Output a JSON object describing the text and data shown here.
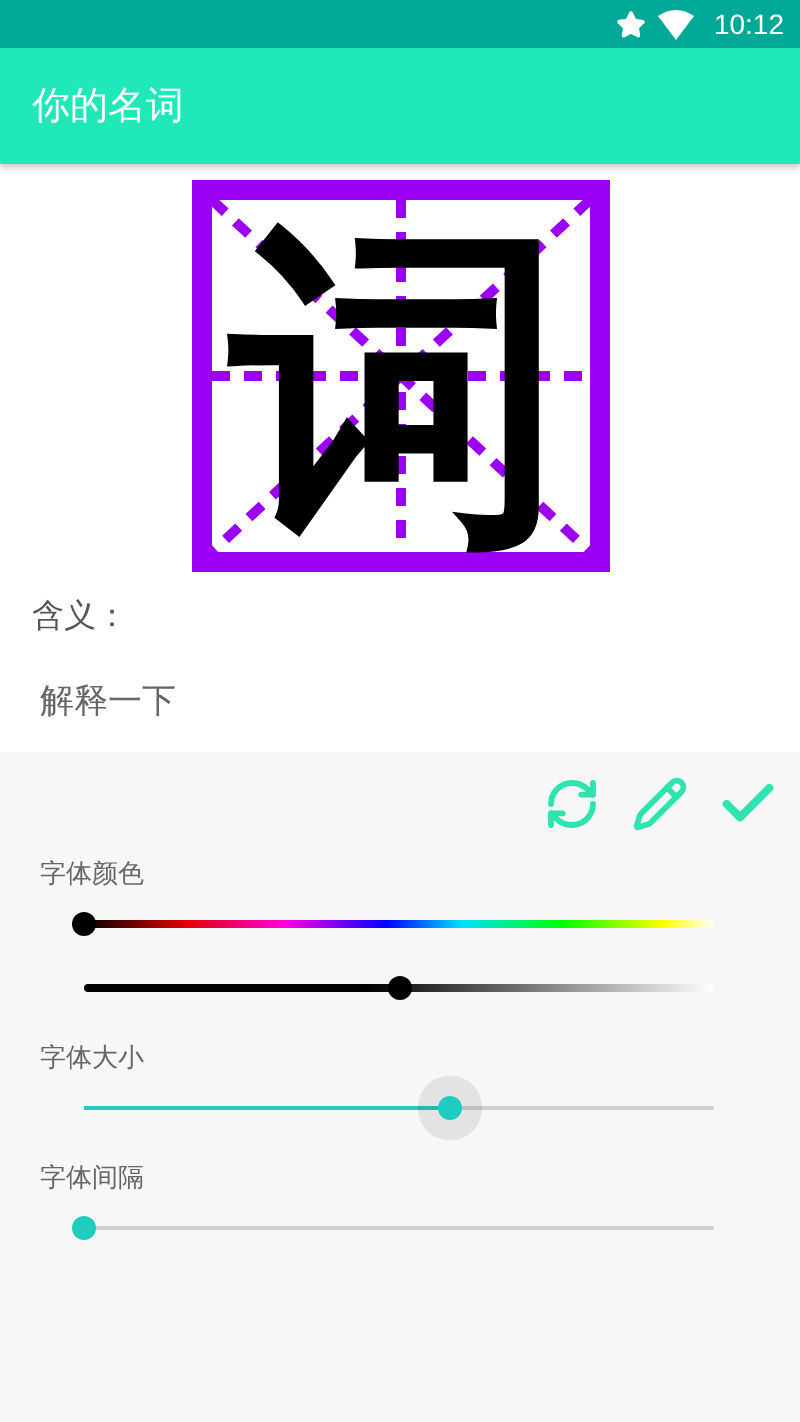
{
  "status_bar": {
    "time": "10:12"
  },
  "app_bar": {
    "title": "你的名词"
  },
  "character": "词",
  "meaning": {
    "label": "含义：",
    "value": "解释一下"
  },
  "groups": [
    {
      "label": "字体颜色",
      "sliders": [
        {
          "kind": "hue",
          "level": 0
        },
        {
          "kind": "shade",
          "level": 0.5
        }
      ]
    },
    {
      "label": "字体大小",
      "sliders": [
        {
          "kind": "plain",
          "level": 0.58,
          "focused": true
        }
      ]
    },
    {
      "label": "字体间隔",
      "sliders": [
        {
          "kind": "plain",
          "level": 0,
          "focused": false
        }
      ]
    }
  ]
}
